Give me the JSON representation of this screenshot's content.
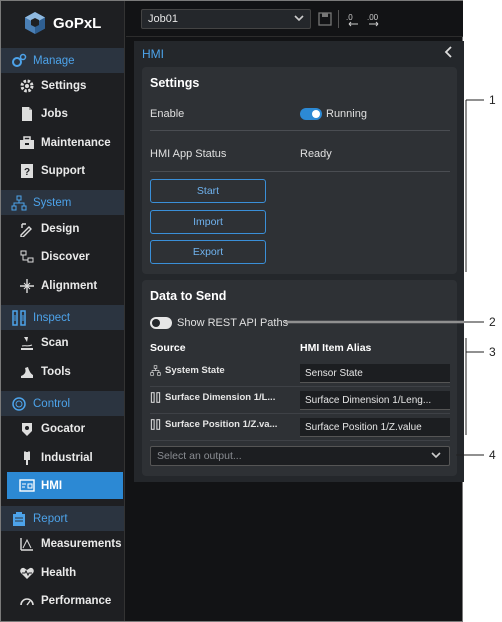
{
  "app": {
    "name": "GoPxL"
  },
  "sidebar": {
    "manage": {
      "label": "Manage",
      "items": [
        {
          "label": "Settings"
        },
        {
          "label": "Jobs"
        },
        {
          "label": "Maintenance"
        },
        {
          "label": "Support"
        }
      ]
    },
    "system": {
      "label": "System",
      "items": [
        {
          "label": "Design"
        },
        {
          "label": "Discover"
        },
        {
          "label": "Alignment"
        }
      ]
    },
    "inspect": {
      "label": "Inspect",
      "items": [
        {
          "label": "Scan"
        },
        {
          "label": "Tools"
        }
      ]
    },
    "control": {
      "label": "Control",
      "items": [
        {
          "label": "Gocator"
        },
        {
          "label": "Industrial"
        },
        {
          "label": "HMI"
        }
      ]
    },
    "report": {
      "label": "Report",
      "items": [
        {
          "label": "Measurements"
        },
        {
          "label": "Health"
        },
        {
          "label": "Performance"
        }
      ]
    }
  },
  "topbar": {
    "job": "Job01"
  },
  "panel": {
    "title": "HMI",
    "settings": {
      "title": "Settings",
      "enable_label": "Enable",
      "running_label": "Running",
      "enabled": true,
      "status_label": "HMI App Status",
      "status_value": "Ready",
      "buttons": {
        "start": "Start",
        "import": "Import",
        "export": "Export"
      }
    },
    "data_to_send": {
      "title": "Data to Send",
      "show_paths_label": "Show REST API Paths",
      "show_paths": false,
      "col_source": "Source",
      "col_alias": "HMI Item Alias",
      "rows": [
        {
          "source": "System State",
          "alias": "Sensor State"
        },
        {
          "source": "Surface Dimension 1/L...",
          "alias": "Surface Dimension 1/Leng..."
        },
        {
          "source": "Surface Position 1/Z.va...",
          "alias": "Surface Position 1/Z.value"
        }
      ],
      "output_placeholder": "Select an output..."
    }
  },
  "callouts": [
    "1",
    "2",
    "3",
    "4"
  ],
  "colors": {
    "accent": "#2c89d4",
    "section_text": "#4da3ea",
    "panel_bg": "#24272b",
    "card_bg": "#2e3135"
  }
}
